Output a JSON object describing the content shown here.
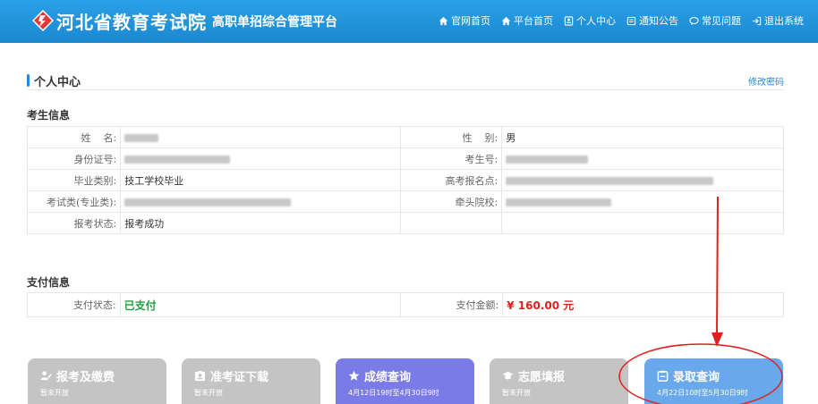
{
  "header": {
    "logo_main": "河北省教育考试院",
    "logo_sub": "高职单招综合管理平台",
    "nav": [
      {
        "label": "官网首页",
        "icon": "home-icon"
      },
      {
        "label": "平台首页",
        "icon": "home-icon"
      },
      {
        "label": "个人中心",
        "icon": "profile-icon"
      },
      {
        "label": "通知公告",
        "icon": "notice-icon"
      },
      {
        "label": "常见问题",
        "icon": "chat-icon"
      },
      {
        "label": "退出系统",
        "icon": "logout-icon"
      }
    ]
  },
  "page": {
    "title": "个人中心",
    "change_password": "修改密码"
  },
  "candidate": {
    "section_title": "考生信息",
    "name_label": "姓    名:",
    "gender_label": "性    别:",
    "gender_value": "男",
    "id_label": "身份证号:",
    "exam_no_label": "考生号:",
    "grad_type_label": "毕业类别:",
    "grad_type_value": "技工学校毕业",
    "reg_site_label": "高考报名点:",
    "exam_type_label": "考试类(专业类):",
    "lead_school_label": "牵头院校:",
    "status_label": "报考状态:",
    "status_value": "报考成功"
  },
  "payment": {
    "section_title": "支付信息",
    "status_label": "支付状态:",
    "status_value": "已支付",
    "amount_label": "支付金额:",
    "amount_value": "¥ 160.00 元"
  },
  "cards": [
    {
      "title": "报考及缴费",
      "sub": "暂未开放",
      "icon": "user-edit-icon",
      "style": "gray"
    },
    {
      "title": "准考证下载",
      "sub": "暂未开放",
      "icon": "id-card-icon",
      "style": "gray"
    },
    {
      "title": "成绩查询",
      "sub": "4月12日19时至4月30日9时",
      "icon": "star-icon",
      "style": "purple"
    },
    {
      "title": "志愿填报",
      "sub": "暂未开放",
      "icon": "graduation-cap-icon",
      "style": "gray"
    },
    {
      "title": "录取查询",
      "sub": "4月22日10时至5月30日9时",
      "icon": "clipboard-icon",
      "style": "blue"
    }
  ]
}
